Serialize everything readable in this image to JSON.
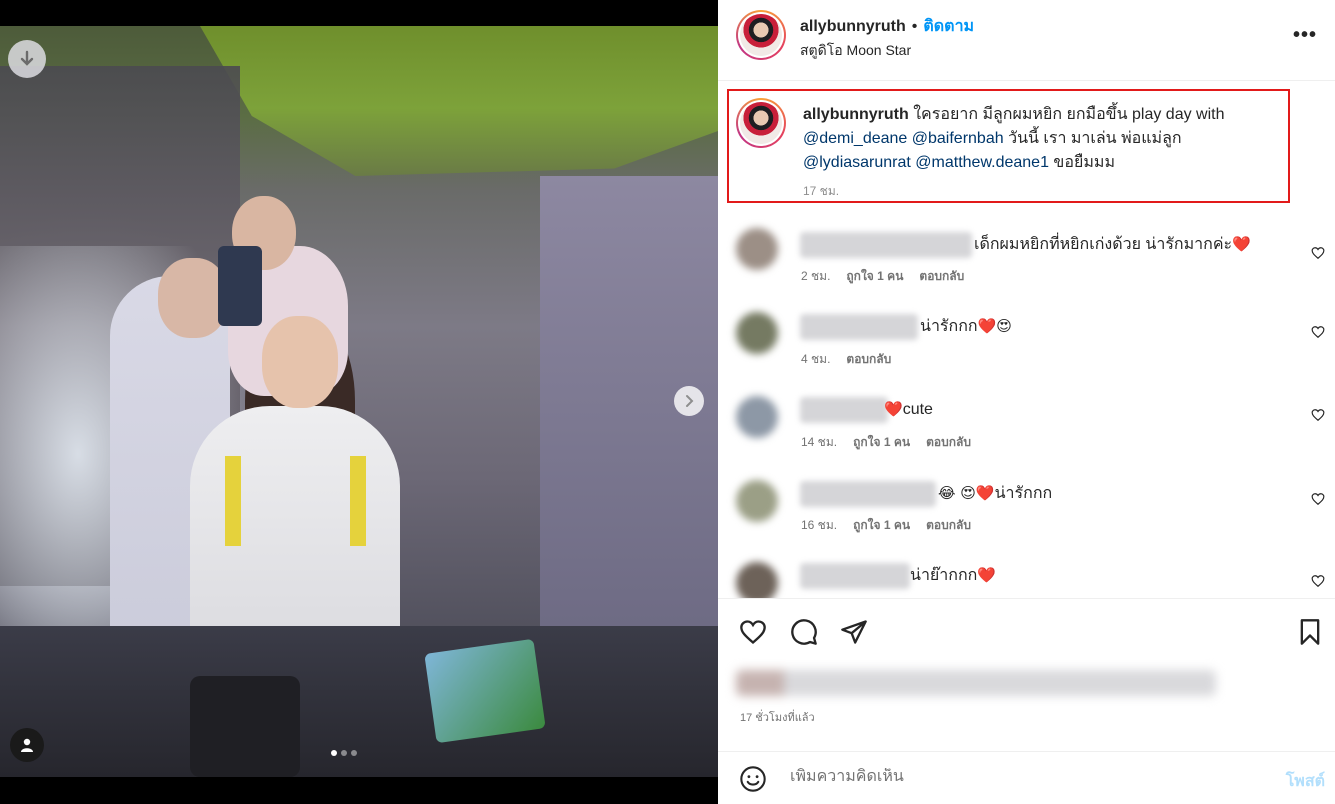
{
  "post": {
    "username": "allybunnyruth",
    "separator": "•",
    "follow_label": "ติดตาม",
    "location": "สตูดิโอ Moon Star",
    "more_label": "•••"
  },
  "caption": {
    "username": "allybunnyruth",
    "text_1": "ใครอยาก มีลูกผมหยิก ยกมือขึ้น play day with",
    "mention_1": "@demi_deane",
    "mention_2": "@baifernbah",
    "text_2": "วันนี้ เรา มาเล่น พ่อแม่ลูก",
    "mention_3": "@lydiasarunrat",
    "mention_4": "@matthew.deane1",
    "text_3": "ขอยืมมม",
    "time": "17 ชม."
  },
  "comments": [
    {
      "text": "เด็กผมหยิกที่หยิกเก่งด้วย น่ารักมากค่ะ",
      "emoji": "❤️",
      "time": "2 ชม.",
      "likes": "ถูกใจ 1 คน",
      "reply": "ตอบกลับ"
    },
    {
      "text": "น่ารักกก",
      "emoji": "❤️😍",
      "time": "4 ชม.",
      "likes": "",
      "reply": "ตอบกลับ"
    },
    {
      "text": "cute",
      "emoji": "❤️",
      "time": "14 ชม.",
      "likes": "ถูกใจ 1 คน",
      "reply": "ตอบกลับ"
    },
    {
      "text": "น่ารักกก",
      "emoji": "😂 😍❤️",
      "time": "16 ชม.",
      "likes": "ถูกใจ 1 คน",
      "reply": "ตอบกลับ"
    },
    {
      "text": "น่าย๊ากกก",
      "emoji": "❤️",
      "time": "",
      "likes": "",
      "reply": ""
    }
  ],
  "footer": {
    "post_time": "17 ชั่วโมงที่แล้ว",
    "comment_placeholder": "เพิ่มความคิดเห็น",
    "post_label": "โพสต์"
  },
  "colors": {
    "accent": "#0095f6",
    "highlight_border": "#e21a1a",
    "mention": "#00376b"
  },
  "icons": [
    "download-icon",
    "chevron-right-icon",
    "user-tag-icon",
    "more-icon",
    "heart-icon",
    "comment-icon",
    "share-icon",
    "bookmark-icon",
    "emoji-icon"
  ],
  "carousel": {
    "total": 3,
    "active": 1
  }
}
